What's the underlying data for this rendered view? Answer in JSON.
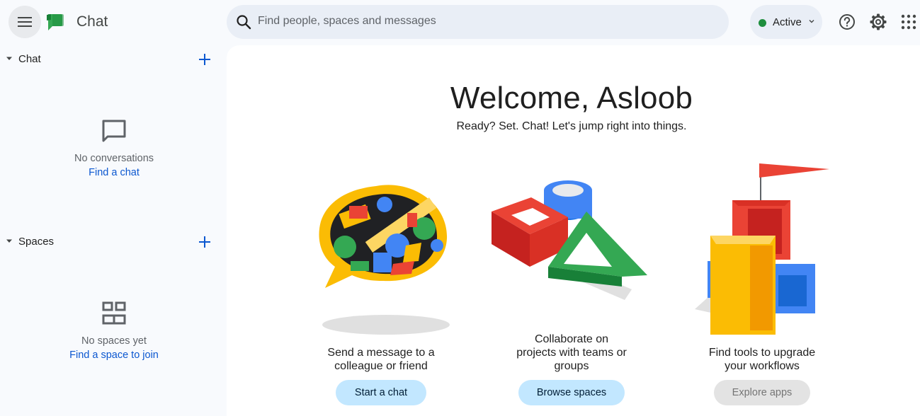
{
  "header": {
    "app_title": "Chat",
    "search_placeholder": "Find people, spaces and messages",
    "status_label": "Active"
  },
  "sidebar": {
    "chat_section": {
      "label": "Chat",
      "empty_text": "No conversations",
      "empty_link": "Find a chat"
    },
    "spaces_section": {
      "label": "Spaces",
      "empty_text": "No spaces yet",
      "empty_link": "Find a space to join"
    }
  },
  "main": {
    "welcome_title": "Welcome, Asloob",
    "welcome_subtitle": "Ready? Set. Chat! Let's jump right into things.",
    "cards": [
      {
        "description_lines": [
          "Send a message to a",
          "colleague or friend"
        ],
        "button_label": "Start a chat",
        "illustration": "speech-bubble-blocks-illustration"
      },
      {
        "description_lines": [
          "Collaborate on",
          "projects with teams or",
          "groups"
        ],
        "button_label": "Browse spaces",
        "illustration": "shapes-blocks-illustration"
      },
      {
        "description_lines": [
          "Find tools to upgrade",
          "your workflows"
        ],
        "button_label": "Explore apps",
        "illustration": "building-flag-illustration"
      }
    ]
  },
  "colors": {
    "accent": "#0b57d0",
    "status_active": "#1e8e3e",
    "button_primary_bg": "#c2e7ff",
    "button_disabled_bg": "#e3e3e3",
    "surface": "#f8fafd",
    "search_bg": "#e9eef6"
  },
  "icons": [
    "hamburger-menu-icon",
    "google-chat-logo",
    "search-icon",
    "chevron-down-icon",
    "help-icon",
    "gear-icon",
    "apps-grid-icon",
    "caret-down-icon",
    "plus-icon",
    "chat-bubble-icon",
    "spaces-grid-icon"
  ]
}
